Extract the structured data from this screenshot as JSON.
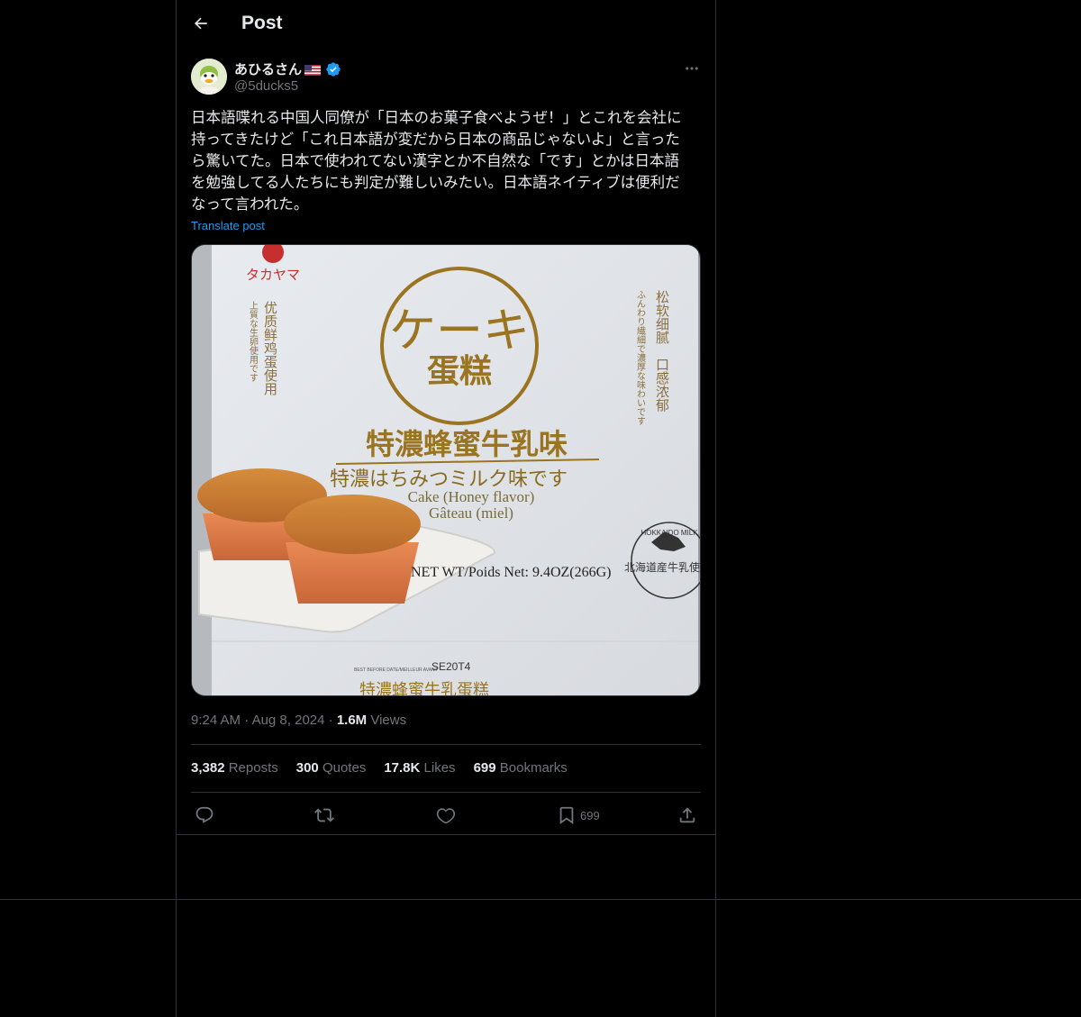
{
  "header": {
    "title": "Post"
  },
  "author": {
    "display_name": "あひるさん",
    "flag": "🇺🇸",
    "handle": "@5ducks5",
    "verified_color": "#1d9bf0"
  },
  "post": {
    "text_lines": [
      "日本語喋れる中国人同僚が「日本のお菓子食べようぜ！」とこれを会社に",
      "持ってきたけど「これ日本語が変だから日本の商品じゃないよ」と言った",
      "ら驚いてた。日本で使われてない漢字とか不自然な「です」とかは日本語",
      "を勉強してる人たちにも判定が難しいみたい。日本語ネイティブは便利だ",
      "なって言われた。"
    ],
    "translate_label": "Translate post"
  },
  "media": {
    "brand": "タカヤマ",
    "cake_jp": "ケーキ",
    "cake_cn": "蛋糕",
    "flavor_cn": "特濃蜂蜜牛乳味",
    "flavor_jp": "特濃はちみつミルク味です",
    "name_en": "Cake (Honey flavor)",
    "name_fr": "Gâteau (miel)",
    "net_wt": "NET WT/Poids Net: 9.4OZ(266G)",
    "left_vertical_1": "优质鲜鸡蛋使用",
    "left_vertical_2": "上質な生卵使用です",
    "right_vertical_1": "松软细腻　口感浓郁",
    "right_vertical_2": "ふんわり繊細で濃厚な味わいです",
    "seal_text": "北海道産牛乳使用",
    "seal_ring": "HOKKAIDO MILK",
    "lot": "SE20T4",
    "best_before": "BEST BEFORE DATE/MEILLEUR AVANT",
    "bottom_text": "特濃蜂蜜牛乳蛋糕"
  },
  "meta": {
    "time": "9:24 AM",
    "date": "Aug 8, 2024",
    "views_count": "1.6M",
    "views_label": "Views"
  },
  "stats": {
    "reposts_count": "3,382",
    "reposts_label": "Reposts",
    "quotes_count": "300",
    "quotes_label": "Quotes",
    "likes_count": "17.8K",
    "likes_label": "Likes",
    "bookmarks_count": "699",
    "bookmarks_label": "Bookmarks"
  },
  "actions": {
    "bookmark_count": "699"
  },
  "colors": {
    "background": "#000000",
    "text": "#e7e9ea",
    "muted": "#71767b",
    "border": "#2f3336",
    "accent": "#1d9bf0",
    "gold": "#9a7420"
  }
}
